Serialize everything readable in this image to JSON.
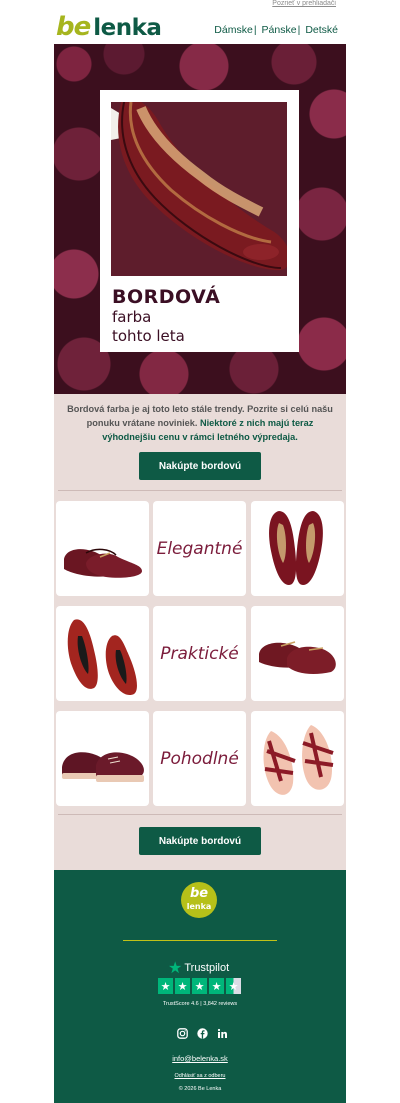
{
  "top": {
    "view_in_browser": "Pozrieť v prehliadači"
  },
  "header": {
    "logo_be": "be",
    "logo_lenka": "lenka",
    "nav": [
      "Dámske",
      "Pánske",
      "Detské"
    ],
    "nav_separator": "|"
  },
  "hero": {
    "title": "BORDOVÁ",
    "subtitle_line1": "farba",
    "subtitle_line2": "tohto leta"
  },
  "intro": {
    "text_plain": "Bordová farba je aj toto leto stále trendy. Pozrite si celú našu ponuku vrátane noviniek. ",
    "text_highlight": "Niektoré z nich majú teraz výhodnejšiu cenu v rámci letného výpredaja."
  },
  "cta": {
    "label": "Nakúpte bordovú"
  },
  "grid": {
    "words": [
      "Elegantné",
      "Praktické",
      "Pohodlné"
    ]
  },
  "footer": {
    "logo_be": "be",
    "logo_lenka": "lenka",
    "trustpilot_label": "Trustpilot",
    "trustpilot_score": "TrustScore 4.6  |  3,842 reviews",
    "rating_stars": 4.5,
    "email": "info@belenka.sk",
    "unsubscribe": "Odhlásiť sa z odberu",
    "copyright": "© 2026 Be Lenka"
  },
  "colors": {
    "brand_green": "#0e5a45",
    "brand_lime": "#a6b51e",
    "burgundy": "#7b1c3b",
    "panel_bg": "#e9dcd9",
    "trustpilot_green": "#00b67a"
  }
}
